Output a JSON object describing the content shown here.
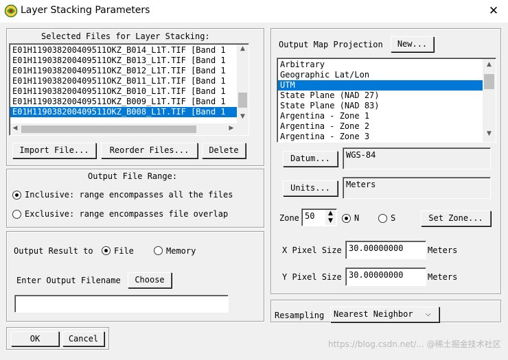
{
  "window": {
    "title": "Layer Stacking Parameters",
    "close_glyph": "✕"
  },
  "selected_files": {
    "heading": "Selected Files for Layer Stacking:",
    "items": [
      "E01H119038200409511OKZ_B014_L1T.TIF [Band 1",
      "E01H119038200409511OKZ_B013_L1T.TIF [Band 1",
      "E01H119038200409511OKZ_B012_L1T.TIF [Band 1",
      "E01H119038200409511OKZ_B011_L1T.TIF [Band 1",
      "E01H119038200409511OKZ_B010_L1T.TIF [Band 1",
      "E01H119038200409511OKZ_B009_L1T.TIF [Band 1",
      "E01H119038200409511OKZ_B008_L1T.TIF [Band 1"
    ],
    "selected_index": 6,
    "buttons": {
      "import": "Import File...",
      "reorder": "Reorder Files...",
      "delete": "Delete"
    }
  },
  "output_range": {
    "heading": "Output File Range:",
    "inclusive": "Inclusive: range encompasses all the files",
    "exclusive": "Exclusive: range encompasses file overlap",
    "selected": "inclusive"
  },
  "output": {
    "result_label": "Output Result to",
    "file_label": "File",
    "memory_label": "Memory",
    "selected": "file",
    "filename_label": "Enter Output Filename",
    "choose_label": "Choose",
    "filename_value": ""
  },
  "footer": {
    "ok": "OK",
    "cancel": "Cancel"
  },
  "projection": {
    "heading": "Output Map Projection",
    "new_button": "New...",
    "items": [
      "Arbitrary",
      "Geographic Lat/Lon",
      "UTM",
      "State Plane (NAD 27)",
      "State Plane (NAD 83)",
      "Argentina - Zone 1",
      "Argentina - Zone 2",
      "Argentina - Zone 3"
    ],
    "selected_index": 2,
    "datum_button": "Datum...",
    "datum_value": "WGS-84",
    "units_button": "Units...",
    "units_value": "Meters",
    "zone_label": "Zone",
    "zone_value": "50",
    "north_label": "N",
    "south_label": "S",
    "hemisphere": "N",
    "set_zone_button": "Set Zone...",
    "x_pixel_label": "X Pixel Size",
    "x_pixel_value": "30.00000000",
    "x_pixel_unit": "Meters",
    "y_pixel_label": "Y Pixel Size",
    "y_pixel_value": "30.00000000",
    "y_pixel_unit": "Meters"
  },
  "resampling": {
    "label": "Resampling",
    "value": "Nearest Neighbor"
  },
  "watermark": "https://blog.csdn.net/...  @稀土掘金技术社区",
  "colors": {
    "selection": "#0078d7",
    "background": "#f0f0f0"
  }
}
